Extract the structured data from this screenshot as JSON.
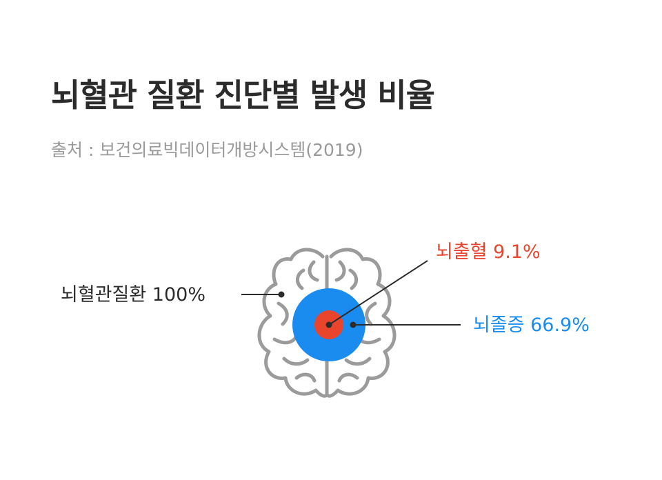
{
  "header": {
    "title": "뇌혈관 질환 진단별 발생 비율",
    "source": "출처 : 보건의료빅데이터개방시스템(2019)"
  },
  "labels": {
    "total": "뇌혈관질환 100%",
    "hemorrhage": "뇌출혈 9.1%",
    "stroke": "뇌졸증 66.9%"
  },
  "colors": {
    "title": "#2b2b2b",
    "source": "#9a9a9a",
    "brain_outline": "#9b9b9b",
    "stroke_circle": "#1a8cf0",
    "hemorrhage_circle": "#e8452c",
    "leader_line": "#2b2b2b"
  }
}
